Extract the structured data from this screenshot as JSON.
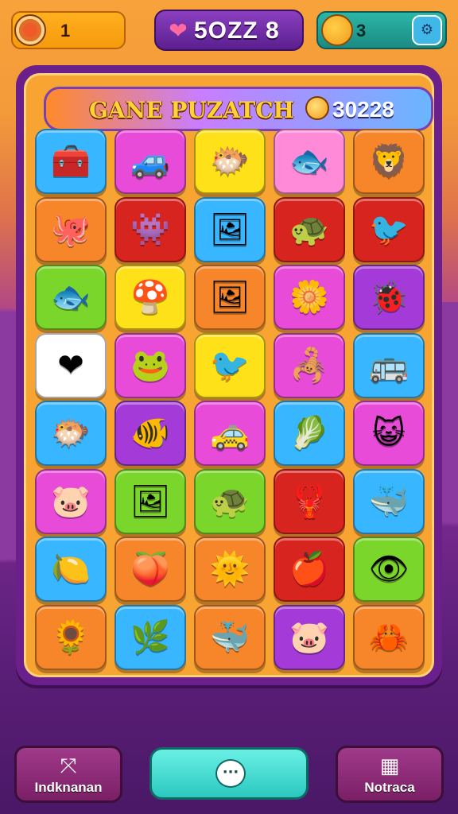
{
  "topbar": {
    "coins": "1",
    "title": "5OZZ 8",
    "lives": "3",
    "settings_icon": "settings-icon"
  },
  "banner": {
    "title": "GANE PUZATCH",
    "score": "30228"
  },
  "colors": {
    "blue": "#38b6ff",
    "magenta": "#e84bd8",
    "yellow": "#ffe11a",
    "pink": "#ff8ad8",
    "orange": "#f7862a",
    "red": "#d8241e",
    "green": "#7ad62a",
    "purple": "#a43ad8",
    "white": "#ffffff"
  },
  "grid": {
    "rows": [
      [
        {
          "color": "blue",
          "icon": "🧰",
          "name": "toolbox-icon"
        },
        {
          "color": "magenta",
          "icon": "🚙",
          "name": "car-icon"
        },
        {
          "color": "yellow",
          "icon": "🐡",
          "name": "fish-icon"
        },
        {
          "color": "pink",
          "icon": "🐟",
          "name": "fish-icon"
        },
        {
          "color": "orange",
          "icon": "🦁",
          "name": "lion-icon"
        }
      ],
      [
        {
          "color": "orange",
          "icon": "🐙",
          "name": "creature-icon"
        },
        {
          "color": "red",
          "icon": "👾",
          "name": "creature-icon"
        },
        {
          "color": "blue",
          "icon": "🖼",
          "name": "frame-icon"
        },
        {
          "color": "red",
          "icon": "🐢",
          "name": "turtle-icon"
        },
        {
          "color": "red",
          "icon": "🐦",
          "name": "bird-icon"
        }
      ],
      [
        {
          "color": "green",
          "icon": "🐟",
          "name": "fish-icon"
        },
        {
          "color": "yellow",
          "icon": "🍄",
          "name": "creature-icon"
        },
        {
          "color": "orange",
          "icon": "🖼",
          "name": "frame-icon"
        },
        {
          "color": "magenta",
          "icon": "🌼",
          "name": "flower-icon"
        },
        {
          "color": "purple",
          "icon": "🐞",
          "name": "bug-icon"
        }
      ],
      [
        {
          "color": "white",
          "icon": "❤",
          "name": "heart-icon"
        },
        {
          "color": "magenta",
          "icon": "🐸",
          "name": "frog-icon"
        },
        {
          "color": "yellow",
          "icon": "🐦",
          "name": "bird-icon"
        },
        {
          "color": "magenta",
          "icon": "🦂",
          "name": "creature-icon"
        },
        {
          "color": "blue",
          "icon": "🚌",
          "name": "bus-icon"
        }
      ],
      [
        {
          "color": "blue",
          "icon": "🐡",
          "name": "fish-icon"
        },
        {
          "color": "purple",
          "icon": "🐠",
          "name": "fish-icon"
        },
        {
          "color": "magenta",
          "icon": "🚕",
          "name": "taxi-icon"
        },
        {
          "color": "blue",
          "icon": "🥬",
          "name": "leaf-icon"
        },
        {
          "color": "magenta",
          "icon": "😺",
          "name": "cat-icon"
        }
      ],
      [
        {
          "color": "magenta",
          "icon": "🐷",
          "name": "pig-icon"
        },
        {
          "color": "green",
          "icon": "🖼",
          "name": "frame-icon"
        },
        {
          "color": "green",
          "icon": "🐢",
          "name": "turtle-icon"
        },
        {
          "color": "red",
          "icon": "🦞",
          "name": "creature-icon"
        },
        {
          "color": "blue",
          "icon": "🐳",
          "name": "whale-icon"
        }
      ],
      [
        {
          "color": "blue",
          "icon": "🍋",
          "name": "lemon-icon"
        },
        {
          "color": "orange",
          "icon": "🍑",
          "name": "peach-icon"
        },
        {
          "color": "orange",
          "icon": "🌞",
          "name": "sun-icon"
        },
        {
          "color": "red",
          "icon": "🍎",
          "name": "apple-icon"
        },
        {
          "color": "green",
          "icon": "👁",
          "name": "eye-icon"
        }
      ],
      [
        {
          "color": "orange",
          "icon": "🌻",
          "name": "flower-icon"
        },
        {
          "color": "blue",
          "icon": "🌿",
          "name": "plant-icon"
        },
        {
          "color": "orange",
          "icon": "🐳",
          "name": "whale-icon"
        },
        {
          "color": "purple",
          "icon": "🐷",
          "name": "pig-icon"
        },
        {
          "color": "orange",
          "icon": "🦀",
          "name": "crab-icon"
        }
      ]
    ]
  },
  "bottombar": {
    "left_label": "Indknanan",
    "right_label": "Notraca",
    "left_icon": "exit-icon",
    "center_icon": "chat-icon",
    "right_icon": "blocks-icon"
  }
}
